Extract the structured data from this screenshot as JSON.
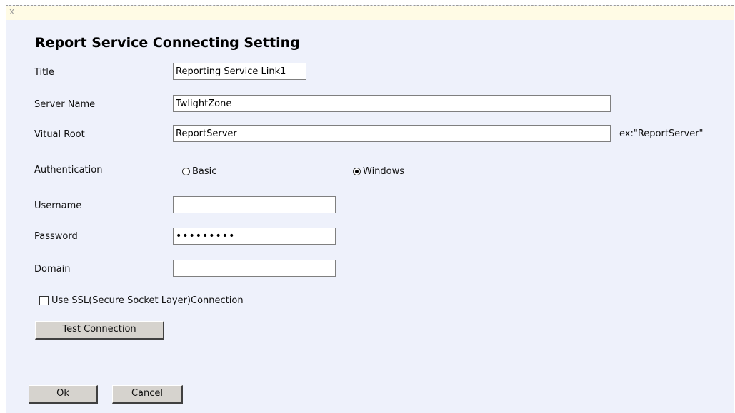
{
  "window": {
    "close_glyph": "x"
  },
  "dialog": {
    "title": "Report Service Connecting Setting"
  },
  "fields": {
    "title": {
      "label": "Title",
      "value": "Reporting Service Link1"
    },
    "server_name": {
      "label": "Server Name",
      "value": "TwlightZone"
    },
    "virtual_root": {
      "label": "Vitual Root",
      "value": "ReportServer",
      "hint": "ex:\"ReportServer\""
    },
    "authentication": {
      "label": "Authentication",
      "options": [
        {
          "label": "Basic",
          "selected": false
        },
        {
          "label": "Windows",
          "selected": true
        }
      ]
    },
    "username": {
      "label": "Username",
      "value": ""
    },
    "password": {
      "label": "Password",
      "value": "•••••••••"
    },
    "domain": {
      "label": "Domain",
      "value": ""
    }
  },
  "ssl": {
    "label": "Use SSL(Secure Socket Layer)Connection",
    "checked": false
  },
  "buttons": {
    "test_connection": "Test Connection",
    "ok": "Ok",
    "cancel": "Cancel"
  },
  "colors": {
    "dialog_bg": "#eef1fb",
    "titlebar_bg": "#fffbe5",
    "button_face": "#d6d3ce"
  }
}
